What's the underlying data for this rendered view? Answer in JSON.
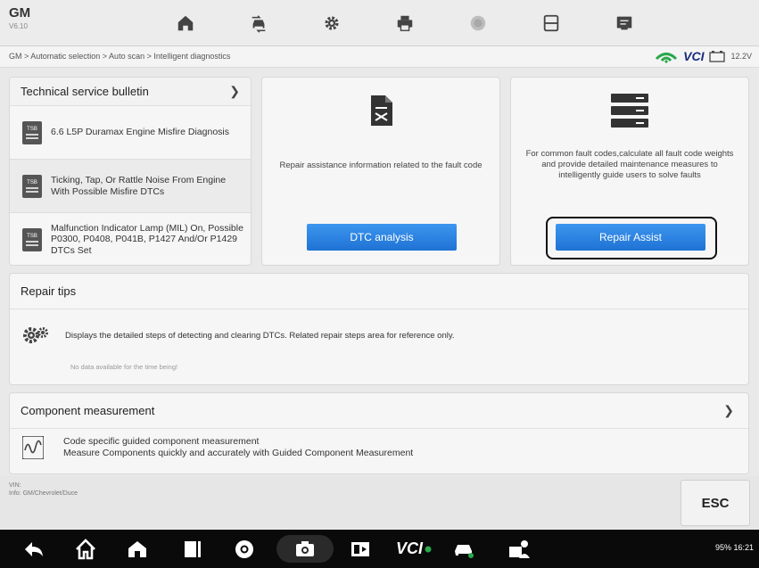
{
  "app": {
    "brand": "GM",
    "version": "V6.10"
  },
  "toolbar": {
    "buttons": [
      {
        "name": "home-icon",
        "label": "Home"
      },
      {
        "name": "vehicle-swap-icon",
        "label": "Vehicle swap"
      },
      {
        "name": "settings-icon",
        "label": "Settings"
      },
      {
        "name": "print-icon",
        "label": "Print"
      },
      {
        "name": "help-icon",
        "label": "Help"
      },
      {
        "name": "save-icon",
        "label": "Save"
      },
      {
        "name": "data-icon",
        "label": "Data"
      }
    ]
  },
  "breadcrumb": "GM > Automatic selection > Auto scan > Intelligent diagnostics",
  "connection": {
    "vci_label": "VCI",
    "voltage": "12.2V"
  },
  "tsb": {
    "title": "Technical service bulletin",
    "icon_label": "TSB",
    "items": [
      {
        "text": "6.6 L5P Duramax Engine Misfire Diagnosis"
      },
      {
        "text": "Ticking, Tap, Or Rattle Noise From Engine With Possible Misfire DTCs"
      },
      {
        "text": "Malfunction Indicator Lamp (MIL) On, Possible P0300, P0408, P041B, P1427 And/Or P1429 DTCs Set"
      }
    ]
  },
  "dtc_card": {
    "description": "Repair assistance information related to the fault code",
    "button_label": "DTC analysis"
  },
  "repair_card": {
    "description": "For common fault codes,calculate all fault code weights and provide detailed maintenance measures to intelligently guide users to solve faults",
    "button_label": "Repair Assist"
  },
  "repair_tips": {
    "title": "Repair tips",
    "text": "Displays the detailed steps of detecting and clearing DTCs. Related repair steps area for reference only.",
    "no_data": "No data available for the time being!"
  },
  "component": {
    "title": "Component measurement",
    "line1": "Code specific guided component measurement",
    "line2": "Measure Components quickly and accurately with Guided Component Measurement"
  },
  "vehicle_info": {
    "vin": "VIN:",
    "info": "Info: GM/Chevrolet/Duce"
  },
  "esc_label": "ESC",
  "navbar": {
    "vci_label": "VCI",
    "status": "95% 16:21"
  },
  "colors": {
    "accent_blue": "#2a83e3",
    "nav_bg": "#0a0a0a",
    "vci_green": "#2aa84a"
  }
}
